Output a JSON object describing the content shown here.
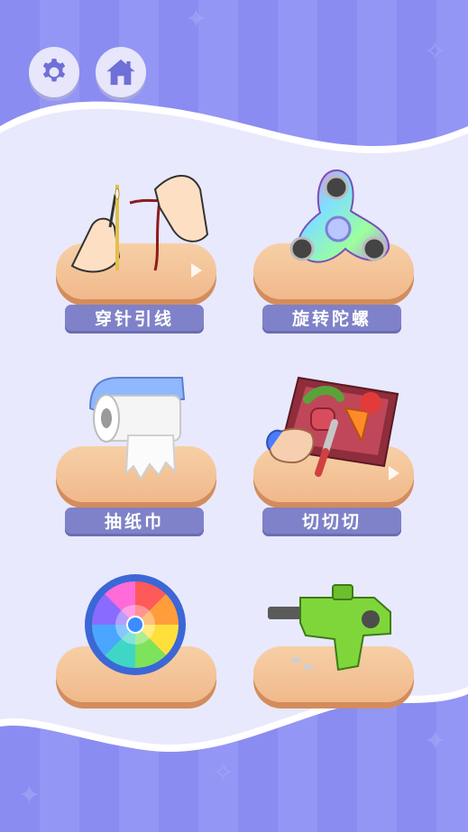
{
  "header": {
    "settings_icon": "gear-icon",
    "home_icon": "home-icon"
  },
  "games": [
    {
      "label": "穿针引线",
      "icon": "needle-thread-icon",
      "has_arrow": true
    },
    {
      "label": "旋转陀螺",
      "icon": "fidget-spinner-icon",
      "has_arrow": false
    },
    {
      "label": "抽纸巾",
      "icon": "tissue-roll-icon",
      "has_arrow": false
    },
    {
      "label": "切切切",
      "icon": "cutting-board-icon",
      "has_arrow": true
    },
    {
      "label": "",
      "icon": "color-wheel-icon",
      "has_arrow": false
    },
    {
      "label": "",
      "icon": "toy-gun-icon",
      "has_arrow": false
    }
  ],
  "colors": {
    "background": "#8e91f3",
    "panel": "#e9e9fc",
    "plate": "#f3c39a",
    "label_bg": "#7f82c8",
    "button_bg": "#e7e6fb",
    "icon": "#6f6fd8"
  }
}
